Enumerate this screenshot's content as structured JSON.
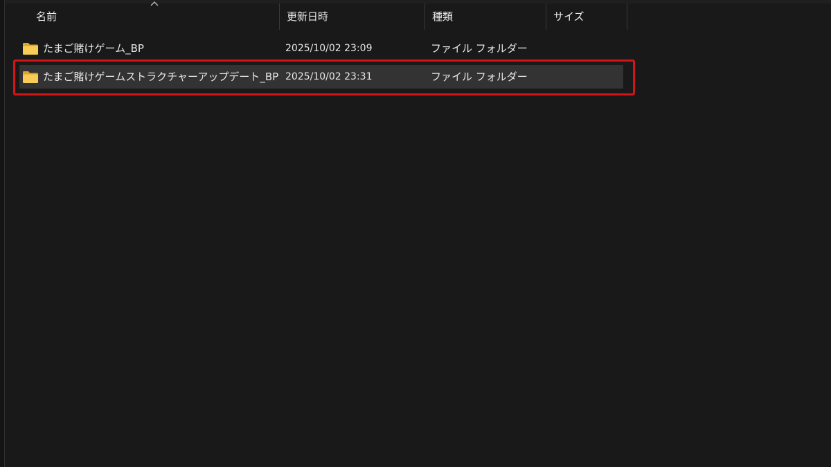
{
  "columns": {
    "name": "名前",
    "date_modified": "更新日時",
    "type": "種類",
    "size": "サイズ"
  },
  "sort_indicator": "chevron-up-icon",
  "rows": [
    {
      "name": "たまご賭けゲーム_BP",
      "date_modified": "2025/10/02 23:09",
      "type": "ファイル フォルダー",
      "icon": "folder-icon",
      "selected": false
    },
    {
      "name": "たまご賭けゲームストラクチャーアップデート_BP",
      "date_modified": "2025/10/02 23:31",
      "type": "ファイル フォルダー",
      "icon": "folder-icon",
      "selected": true
    }
  ],
  "colors": {
    "background": "#191919",
    "selected_row": "#333333",
    "highlight_border": "#d41515",
    "folder": "#f4c54a"
  }
}
